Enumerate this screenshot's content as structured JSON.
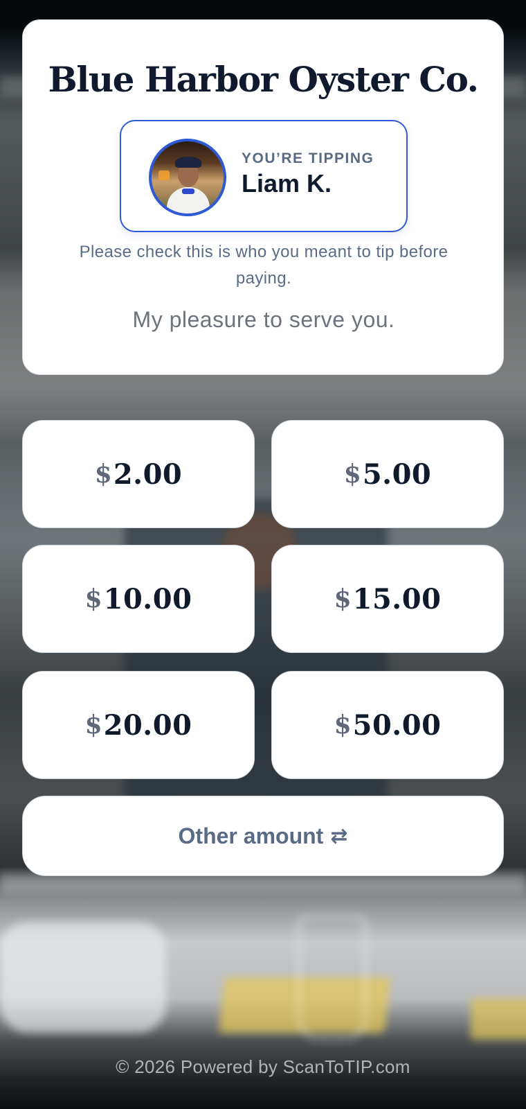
{
  "header": {
    "venue_name": "Blue Harbor Oyster Co."
  },
  "staff": {
    "label": "YOU’RE TIPPING",
    "name": "Liam K.",
    "avatar_icon": "staff-photo",
    "accent_color": "#2f5ad3"
  },
  "notice": {
    "check_text": "Please check this is who you meant to tip before paying.",
    "message": "My pleasure to serve you."
  },
  "amounts": [
    {
      "currency": "$",
      "value": "2.00"
    },
    {
      "currency": "$",
      "value": "5.00"
    },
    {
      "currency": "$",
      "value": "10.00"
    },
    {
      "currency": "$",
      "value": "15.00"
    },
    {
      "currency": "$",
      "value": "20.00"
    },
    {
      "currency": "$",
      "value": "50.00"
    }
  ],
  "other": {
    "label": "Other amount",
    "icon": "⇄"
  },
  "footer": {
    "copyright": "© 2026",
    "powered_by": "Powered by ScanToTIP.com"
  }
}
